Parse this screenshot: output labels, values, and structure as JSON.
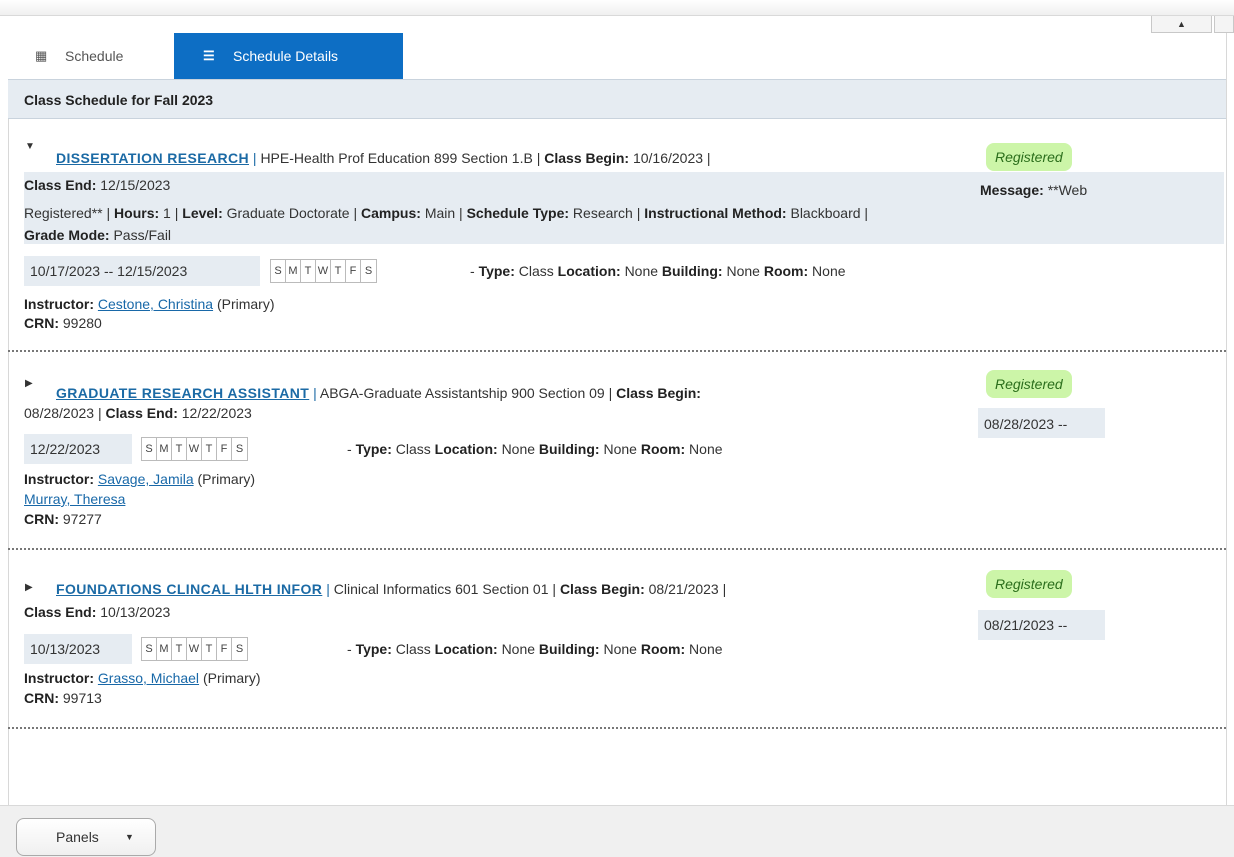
{
  "tabs": [
    {
      "label": "Schedule",
      "icon": "calendar-icon"
    },
    {
      "label": "Schedule Details",
      "icon": "list-details-icon",
      "active": true
    }
  ],
  "panel": {
    "title": "Class Schedule for Fall 2023"
  },
  "day_letters": [
    "S",
    "M",
    "T",
    "W",
    "T",
    "F",
    "S"
  ],
  "labels": {
    "class_begin": "Class Begin:",
    "class_end": "Class End:",
    "type": "Type:",
    "type_val": "Class",
    "location": "Location:",
    "building": "Building:",
    "room": "Room:",
    "instructor": "Instructor:",
    "crn": "CRN:",
    "message": "Message:",
    "hours": "Hours:",
    "level": "Level:",
    "campus": "Campus:",
    "schedule_type": "Schedule Type:",
    "instructional_method": "Instructional Method:",
    "grade_mode": "Grade Mode:",
    "primary": "(Primary)",
    "dash": "-"
  },
  "courses": [
    {
      "title": "DISSERTATION RESEARCH",
      "subject": "HPE-Health Prof Education 899 Section 1.B",
      "class_begin": "10/16/2023",
      "class_end": "12/15/2023",
      "status": "Registered",
      "message_start": "**Web",
      "message_end": "Registered**",
      "hours": "1",
      "level": "Graduate Doctorate",
      "campus": "Main",
      "schedule_type": "Research",
      "instructional_method": "Blackboard",
      "grade_mode": "Pass/Fail",
      "meeting_dates": "10/17/2023 -- 12/15/2023",
      "location": "None",
      "building": "None",
      "room": "None",
      "instructors": [
        "Cestone, Christina"
      ],
      "crn": "99280",
      "expanded": true
    },
    {
      "title": "GRADUATE RESEARCH ASSISTANT",
      "subject": "ABGA-Graduate Assistantship 900 Section 09",
      "class_begin": "08/28/2023",
      "class_end": "12/22/2023",
      "status": "Registered",
      "meeting_start": "08/28/2023 --",
      "meeting_end": "12/22/2023",
      "location": "None",
      "building": "None",
      "room": "None",
      "instructors": [
        "Savage, Jamila",
        "Murray, Theresa"
      ],
      "crn": "97277",
      "expanded": false
    },
    {
      "title": "FOUNDATIONS CLINCAL HLTH INFOR",
      "subject": "Clinical Informatics 601 Section 01",
      "class_begin": "08/21/2023",
      "class_end": "10/13/2023",
      "status": "Registered",
      "meeting_start": "08/21/2023 --",
      "meeting_end": "10/13/2023",
      "location": "None",
      "building": "None",
      "room": "None",
      "instructors": [
        "Grasso, Michael"
      ],
      "crn": "99713",
      "expanded": false
    }
  ],
  "footer": {
    "panels_label": "Panels"
  }
}
